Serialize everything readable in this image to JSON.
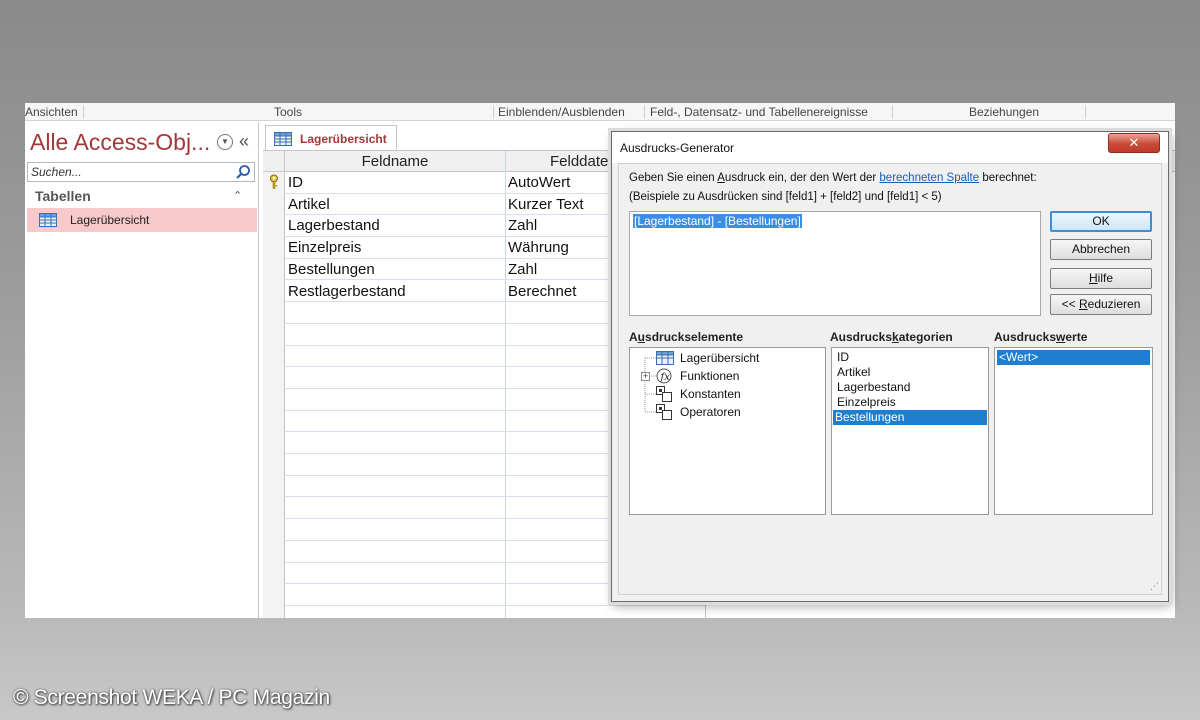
{
  "ribbon": {
    "groups": [
      "Ansichten",
      "Tools",
      "Einblenden/Ausblenden",
      "Feld-, Datensatz- und Tabellenereignisse",
      "Beziehungen"
    ]
  },
  "nav": {
    "title": "Alle Access-Obj...",
    "search_placeholder": "Suchen...",
    "category": "Tabellen",
    "item": "Lagerübersicht"
  },
  "document": {
    "tab_label": "Lagerübersicht",
    "columns": [
      "Feldname",
      "Felddate"
    ],
    "rows": [
      {
        "name": "ID",
        "type": "AutoWert",
        "key": true
      },
      {
        "name": "Artikel",
        "type": "Kurzer Text"
      },
      {
        "name": "Lagerbestand",
        "type": "Zahl"
      },
      {
        "name": "Einzelpreis",
        "type": "Währung"
      },
      {
        "name": "Bestellungen",
        "type": "Zahl"
      },
      {
        "name": "Restlagerbestand",
        "type": "Berechnet"
      }
    ]
  },
  "dialog": {
    "title": "Ausdrucks-Generator",
    "close_label": "✕",
    "instruction_before": "Geben Sie einen ",
    "instruction_accel": "A",
    "instruction_mid": "usdruck ein, der den Wert der ",
    "instruction_link": "berechneten Spalte",
    "instruction_after": " berechnet:",
    "example": "(Beispiele zu Ausdrücken sind [feld1] + [feld2] und [feld1] < 5)",
    "expression": "[Lagerbestand] - [Bestellungen]",
    "buttons": {
      "ok": "OK",
      "cancel": "Abbrechen",
      "help_accel": "H",
      "help_rest": "ilfe",
      "reduce_prefix": "<< ",
      "reduce_accel": "R",
      "reduce_rest": "eduzieren"
    },
    "elements_label_accel": "u",
    "elements_label_a": "A",
    "elements_label_b": "sdruckselemente",
    "categories_label_a": "Ausdrucks",
    "categories_label_accel": "k",
    "categories_label_b": "ategorien",
    "values_label_a": "Ausdrucks",
    "values_label_accel": "w",
    "values_label_b": "erte",
    "elements": [
      "Lagerübersicht",
      "Funktionen",
      "Konstanten",
      "Operatoren"
    ],
    "categories": [
      "ID",
      "Artikel",
      "Lagerbestand",
      "Einzelpreis",
      "Bestellungen"
    ],
    "selected_category": "Bestellungen",
    "values": [
      "<Wert>"
    ]
  },
  "watermark": "© Screenshot WEKA / PC Magazin"
}
